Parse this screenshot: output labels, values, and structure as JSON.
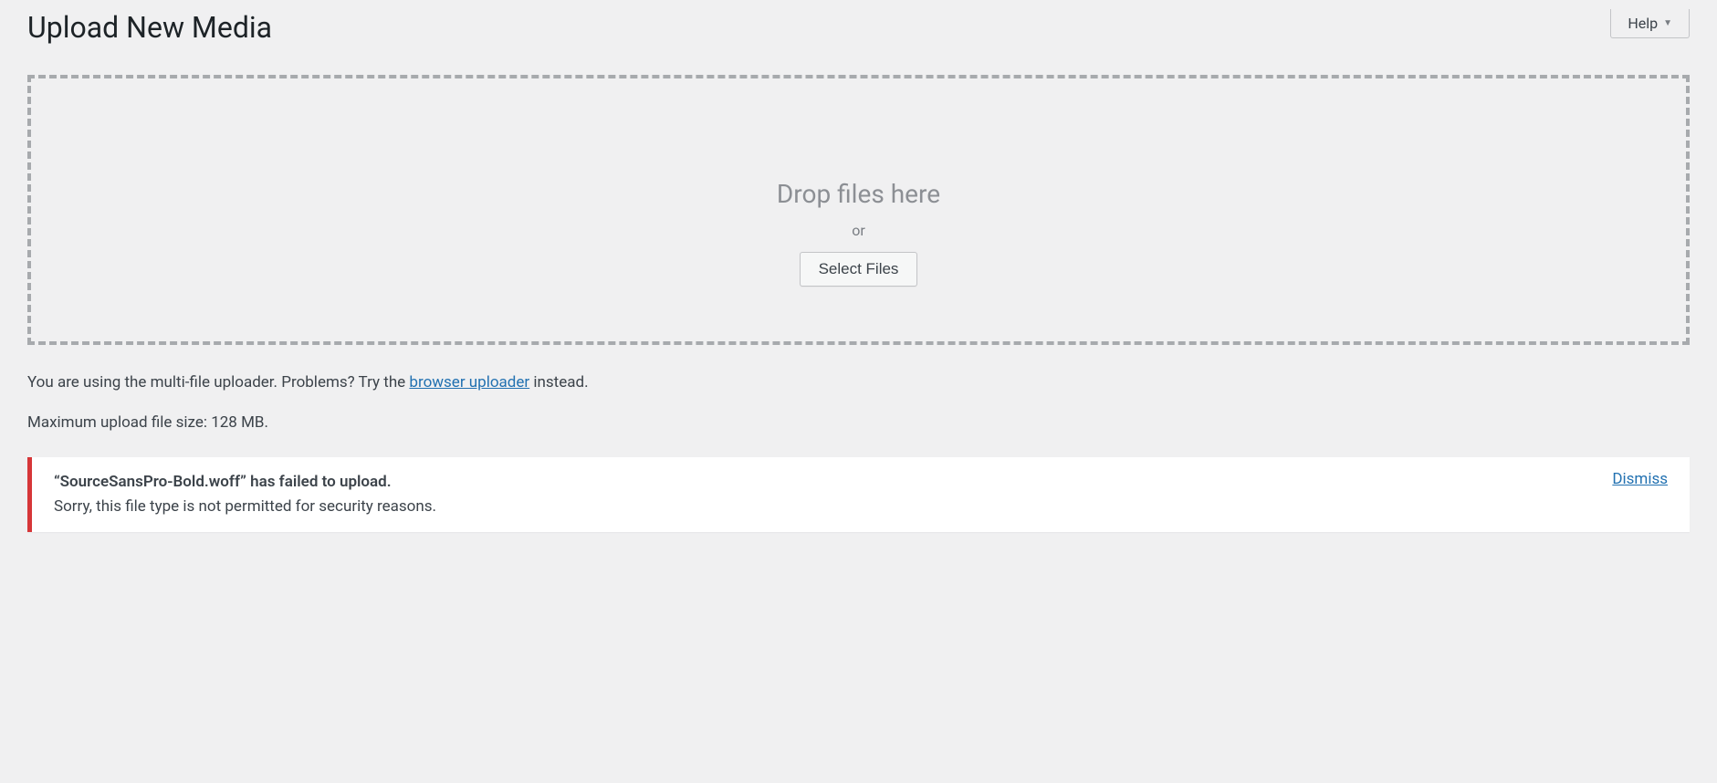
{
  "helpTab": {
    "label": "Help"
  },
  "page": {
    "title": "Upload New Media"
  },
  "dropzone": {
    "title": "Drop files here",
    "or": "or",
    "selectLabel": "Select Files"
  },
  "uploaderNote": {
    "prefix": "You are using the multi-file uploader. Problems? Try the ",
    "link": "browser uploader",
    "suffix": " instead."
  },
  "maxSize": "Maximum upload file size: 128 MB.",
  "error": {
    "headline": "“SourceSansPro-Bold.woff” has failed to upload.",
    "reason": "Sorry, this file type is not permitted for security reasons.",
    "dismiss": "Dismiss"
  }
}
